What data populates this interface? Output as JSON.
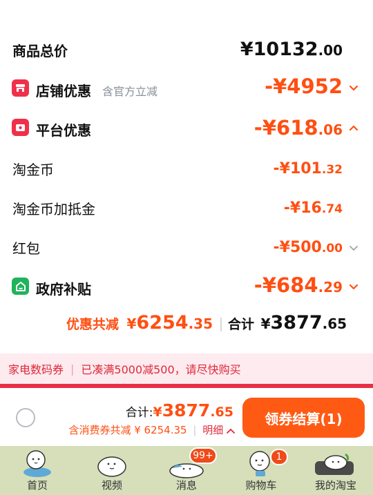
{
  "goods_total": {
    "label": "商品总价",
    "currency": "¥",
    "integer": "10132",
    "decimal": ".00"
  },
  "discounts": [
    {
      "label": "店铺优惠",
      "note": "含官方立减",
      "amount_prefix": "-¥",
      "amount_int": "4952",
      "amount_dec": "",
      "chevron": "down"
    },
    {
      "label": "平台优惠",
      "note": "",
      "amount_prefix": "-¥",
      "amount_int": "618",
      "amount_dec": ".06",
      "chevron": "up"
    },
    {
      "label": "淘金币",
      "amount_prefix": "-¥",
      "amount_int": "101",
      "amount_dec": ".32"
    },
    {
      "label": "淘金币加抵金",
      "amount_prefix": "-¥",
      "amount_int": "16",
      "amount_dec": ".74"
    },
    {
      "label": "红包",
      "amount_prefix": "-¥",
      "amount_int": "500",
      "amount_dec": ".00",
      "chevron": "down"
    },
    {
      "label": "政府补贴",
      "amount_prefix": "-¥",
      "amount_int": "684",
      "amount_dec": ".29",
      "chevron": "down"
    }
  ],
  "summary": {
    "discount_label": "优惠共减",
    "discount_currency": "¥",
    "discount_int": "6254",
    "discount_dec": ".35",
    "total_label": "合计",
    "total_currency": "¥",
    "total_int": "3877",
    "total_dec": ".65"
  },
  "coupon_bar": {
    "category": "家电数码券",
    "message": "已凑满5000减500，请尽快购买"
  },
  "checkout": {
    "total_label": "合计:",
    "total_currency": "¥",
    "total_int": "3877",
    "total_dec": ".65",
    "coupon_text": "含消费券共减 ¥ 6254.35",
    "detail_label": "明细",
    "button_label": "领券结算(1)"
  },
  "tabs": [
    {
      "label": "首页",
      "badge": ""
    },
    {
      "label": "视频",
      "badge": ""
    },
    {
      "label": "消息",
      "badge": "99+"
    },
    {
      "label": "购物车",
      "badge": "1"
    },
    {
      "label": "我的淘宝",
      "badge": ""
    }
  ],
  "colors": {
    "accent": "#ff4f12",
    "button": "#ff5a14",
    "shop_icon": "#f0304b",
    "gov_icon": "#1fb35a",
    "tabbar": "#d6dfba"
  },
  "icons": [
    "store-icon",
    "platform-coupon-icon",
    "government-subsidy-icon",
    "chevron-down-icon",
    "chevron-up-icon",
    "radio-circle-icon",
    "mascot-icons"
  ]
}
